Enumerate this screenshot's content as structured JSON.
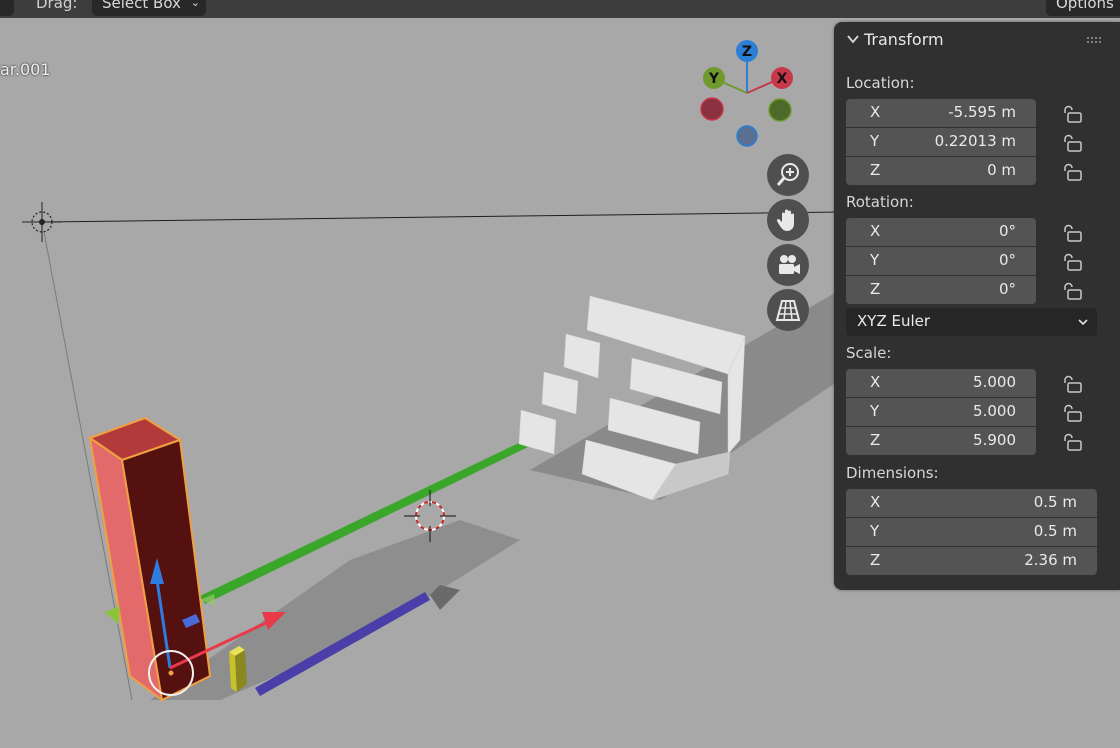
{
  "header": {
    "drag_label": "Drag:",
    "select_mode": "Select Box",
    "options_label": "Options"
  },
  "viewport": {
    "active_object_name": "ar.001"
  },
  "gizmo": {
    "axis_x": "X",
    "axis_y": "Y",
    "axis_z": "Z",
    "color_x": "#c8374a",
    "color_y": "#6e9a2e",
    "color_z": "#2d7fd6"
  },
  "transform": {
    "title": "Transform",
    "location": {
      "label": "Location:",
      "rows": [
        {
          "axis": "X",
          "value": "-5.595 m"
        },
        {
          "axis": "Y",
          "value": "0.22013 m"
        },
        {
          "axis": "Z",
          "value": "0 m"
        }
      ]
    },
    "rotation": {
      "label": "Rotation:",
      "rows": [
        {
          "axis": "X",
          "value": "0°"
        },
        {
          "axis": "Y",
          "value": "0°"
        },
        {
          "axis": "Z",
          "value": "0°"
        }
      ],
      "mode": "XYZ Euler"
    },
    "scale": {
      "label": "Scale:",
      "rows": [
        {
          "axis": "X",
          "value": "5.000"
        },
        {
          "axis": "Y",
          "value": "5.000"
        },
        {
          "axis": "Z",
          "value": "5.900"
        }
      ]
    },
    "dimensions": {
      "label": "Dimensions:",
      "rows": [
        {
          "axis": "X",
          "value": "0.5 m"
        },
        {
          "axis": "Y",
          "value": "0.5 m"
        },
        {
          "axis": "Z",
          "value": "2.36 m"
        }
      ]
    }
  },
  "icons": {
    "zoom": "zoom-icon",
    "pan": "hand-icon",
    "camera": "camera-icon",
    "perspective": "grid-icon",
    "lock": "padlock-icon"
  }
}
